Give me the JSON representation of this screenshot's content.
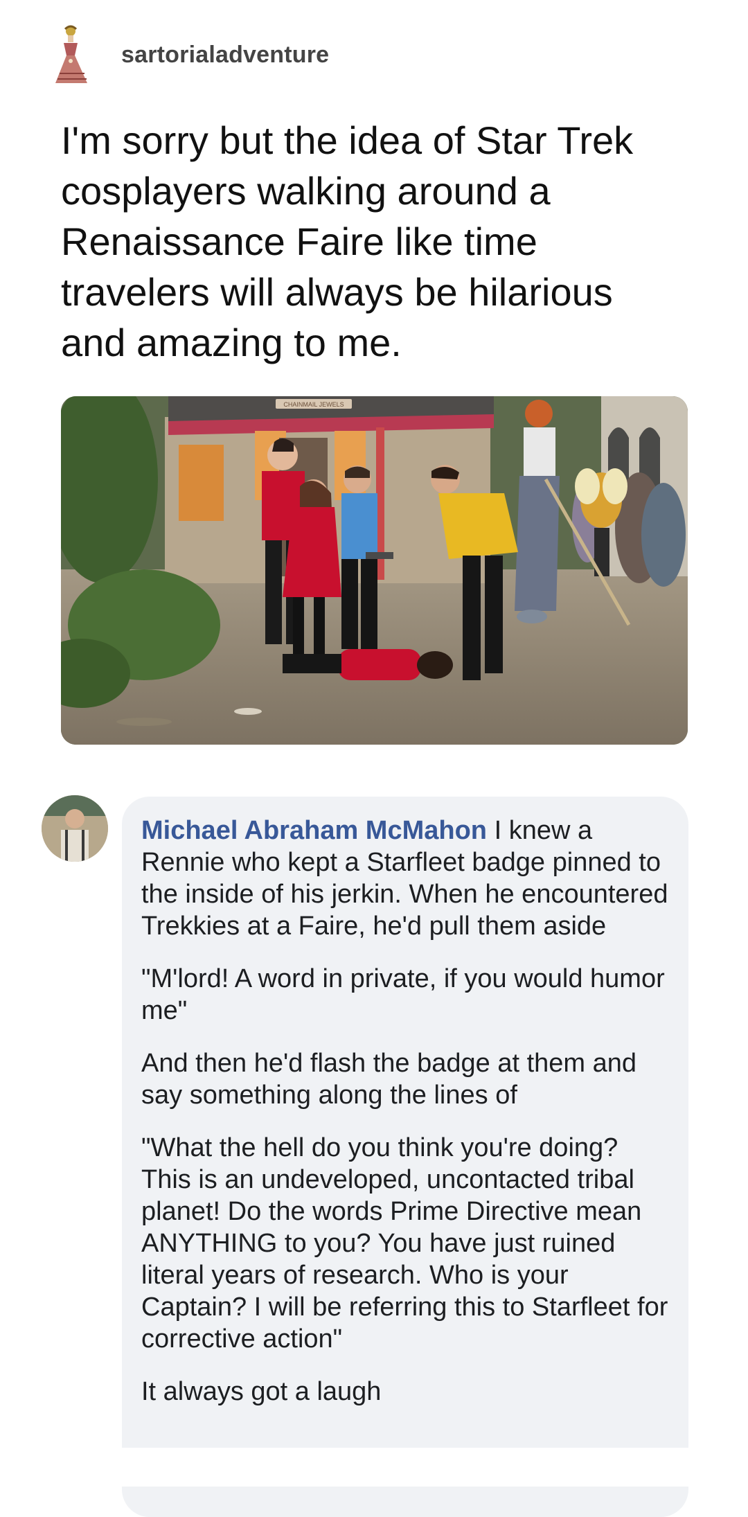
{
  "post": {
    "blog_name": "sartorialadventure",
    "text": "I'm sorry but the idea of Star Trek cosplayers walking around a Renaissance Faire like time travelers will always be hilarious and amazing to me."
  },
  "photo": {
    "sign_text": "CHAINMAIL JEWELS"
  },
  "comment": {
    "author": "Michael Abraham McMahon",
    "paragraphs": [
      "I knew a Rennie who kept a Starfleet badge pinned to the inside of his jerkin. When he encountered Trekkies at a Faire, he'd pull them aside",
      "\"M'lord! A word in private, if you would humor me\"",
      "And then he'd flash the badge at them and say something along the lines of",
      "\"What the hell do you think you're doing? This is an undeveloped, uncontacted tribal planet! Do the words Prime Directive mean ANYTHING to you? You have just ruined literal years of research. Who is your Captain? I will be referring this to Starfleet for corrective action\"",
      "It always got a laugh"
    ]
  },
  "colors": {
    "name_link": "#385898",
    "bubble_bg": "#f0f2f5",
    "starfleet_red": "#c8102e",
    "starfleet_gold": "#e8b923",
    "starfleet_blue": "#4a8fd0"
  },
  "icons": {
    "blog_avatar": "victorian-dress-avatar-icon",
    "commenter_avatar": "profile-photo-avatar"
  }
}
